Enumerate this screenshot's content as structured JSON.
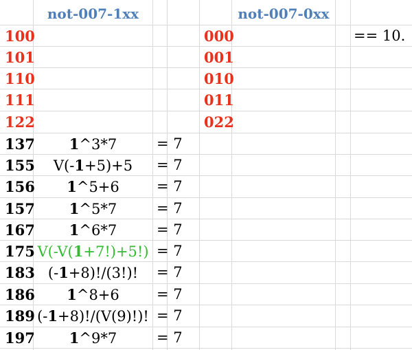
{
  "headers": {
    "left": "not-007-1xx",
    "right": "not-007-0xx"
  },
  "note": "== 10.",
  "colors": {
    "header": "#4e7fb8",
    "red": "#e8321e",
    "green": "#33bb33",
    "grid": "#d9d9d9"
  },
  "red_left": [
    "100",
    "101",
    "110",
    "111",
    "122"
  ],
  "red_right": [
    "000",
    "001",
    "010",
    "011",
    "022"
  ],
  "rows": [
    {
      "num": "137",
      "expr": [
        {
          "t": "1",
          "b": true
        },
        {
          "t": "^3*7"
        }
      ],
      "eq": "= 7"
    },
    {
      "num": "155",
      "expr": [
        {
          "t": "V(-"
        },
        {
          "t": "1",
          "b": true
        },
        {
          "t": "+5)+5"
        }
      ],
      "eq": "= 7"
    },
    {
      "num": "156",
      "expr": [
        {
          "t": "1",
          "b": true
        },
        {
          "t": "^5+6"
        }
      ],
      "eq": "= 7"
    },
    {
      "num": "157",
      "expr": [
        {
          "t": "1",
          "b": true
        },
        {
          "t": "^5*7"
        }
      ],
      "eq": "= 7"
    },
    {
      "num": "167",
      "expr": [
        {
          "t": "1",
          "b": true
        },
        {
          "t": "^6*7"
        }
      ],
      "eq": "= 7"
    },
    {
      "num": "175",
      "expr": [
        {
          "t": "V(-V("
        },
        {
          "t": "1",
          "b": true
        },
        {
          "t": "+7!)+5!)"
        }
      ],
      "eq": "= 7",
      "green": true
    },
    {
      "num": "183",
      "expr": [
        {
          "t": "(-"
        },
        {
          "t": "1",
          "b": true
        },
        {
          "t": "+8)!/(3!)!"
        }
      ],
      "eq": "= 7"
    },
    {
      "num": "186",
      "expr": [
        {
          "t": "1",
          "b": true
        },
        {
          "t": "^8+6"
        }
      ],
      "eq": "= 7"
    },
    {
      "num": "189",
      "expr": [
        {
          "t": "(-"
        },
        {
          "t": "1",
          "b": true
        },
        {
          "t": "+8)!/(V(9)!)!"
        }
      ],
      "eq": "= 7"
    },
    {
      "num": "197",
      "expr": [
        {
          "t": "1",
          "b": true
        },
        {
          "t": "^9*7"
        }
      ],
      "eq": "= 7"
    }
  ]
}
